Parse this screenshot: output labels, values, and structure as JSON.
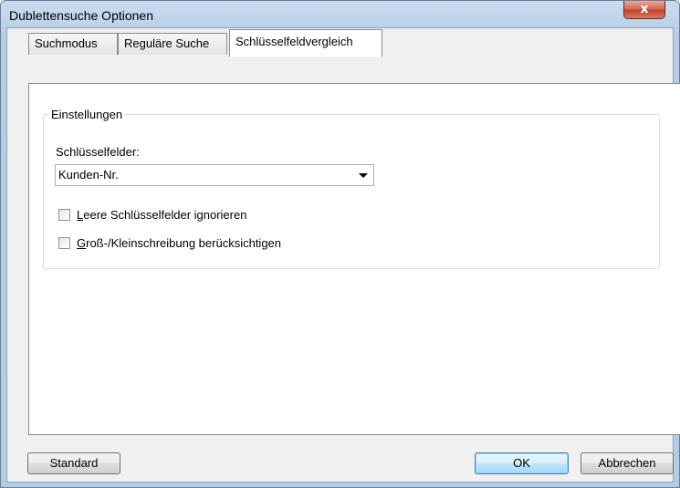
{
  "window": {
    "title": "Dublettensuche Optionen",
    "close_glyph": "x"
  },
  "tabs": [
    {
      "label": "Suchmodus"
    },
    {
      "label": "Reguläre Suche"
    },
    {
      "label": "Schlüsselfeldvergleich"
    }
  ],
  "group": {
    "title": "Einstellungen",
    "key_fields_label": "Schlüsselfelder:",
    "key_fields_value": "Kunden-Nr.",
    "checkbox_ignore_empty": {
      "mnemonic": "L",
      "rest": "eere Schlüsselfelder ignorieren",
      "checked": false
    },
    "checkbox_case": {
      "mnemonic": "G",
      "rest": "roß-/Kleinschreibung berücksichtigen",
      "checked": false
    }
  },
  "buttons": {
    "standard": "Standard",
    "ok": "OK",
    "cancel": "Abbrechen"
  }
}
